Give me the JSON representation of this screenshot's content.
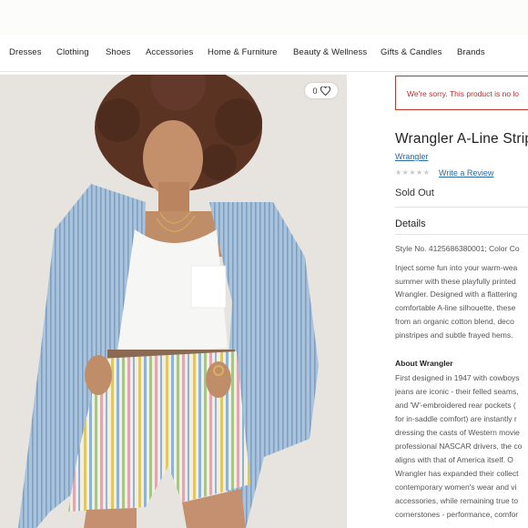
{
  "nav": {
    "items": [
      "Dresses",
      "Clothing",
      "Shoes",
      "Accessories",
      "Home & Furniture",
      "Beauty & Wellness",
      "Gifts & Candles",
      "Brands"
    ]
  },
  "product": {
    "favorite_count": "0",
    "alert": "We're sorry. This product is no lo",
    "title": "Wrangler A-Line Strip",
    "brand": "Wrangler",
    "stars": "★★★★★",
    "write_review": "Write a Review",
    "status": "Sold Out",
    "details_heading": "Details",
    "style_no": "Style No. 4125686380001; Color Co",
    "description_lines": [
      "Inject some fun into your warm-wea",
      "summer with these playfully printed",
      "Wrangler. Designed with a flattering",
      "comfortable A-line silhouette, these",
      "from an organic cotton blend, deco",
      "pinstripes and subtle frayed hems."
    ],
    "about_heading": "About Wrangler",
    "about_lines": [
      "First designed in 1947 with cowboys",
      "jeans are iconic - their felled seams,",
      "and 'W'-embroidered rear pockets (",
      "for in-saddle comfort) are instantly r",
      "dressing the casts of Western movie",
      "professional NASCAR drivers, the co",
      "aligns with that of America itself. O",
      "Wrangler has expanded their collect",
      "contemporary women's wear and vi",
      "accessories, while remaining true to",
      "cornerstones - performance, comfor"
    ]
  }
}
